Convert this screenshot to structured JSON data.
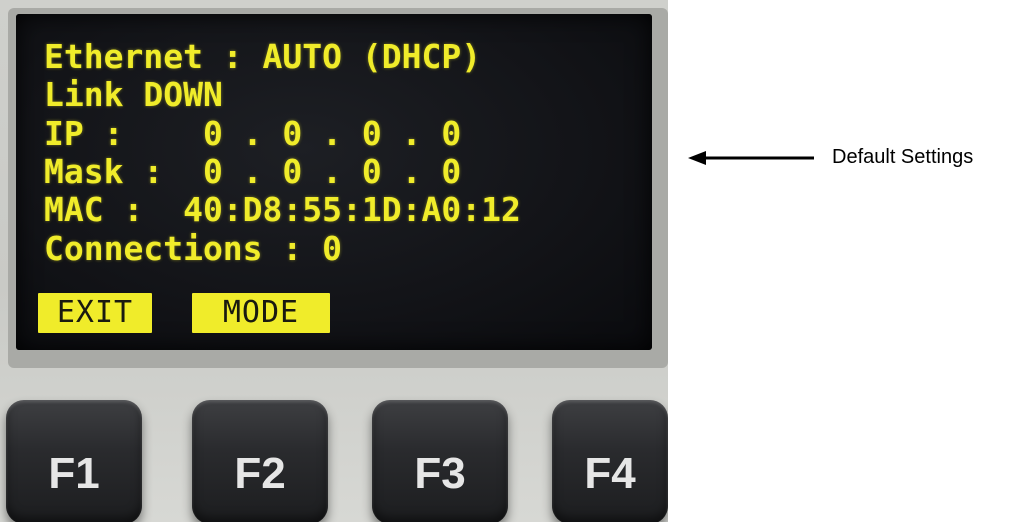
{
  "display": {
    "lines": [
      "Ethernet : AUTO (DHCP)",
      "Link DOWN",
      "IP :    0 . 0 . 0 . 0",
      "Mask :  0 . 0 . 0 . 0",
      "MAC :  40:D8:55:1D:A0:12",
      "Connections : 0"
    ],
    "softkeys": {
      "left": "EXIT",
      "right": "MODE"
    },
    "text_color": "#f0ec2a",
    "background_color": "#111216"
  },
  "keypad": {
    "buttons": [
      "F1",
      "F2",
      "F3",
      "F4"
    ]
  },
  "annotation": {
    "label": "Default Settings"
  }
}
